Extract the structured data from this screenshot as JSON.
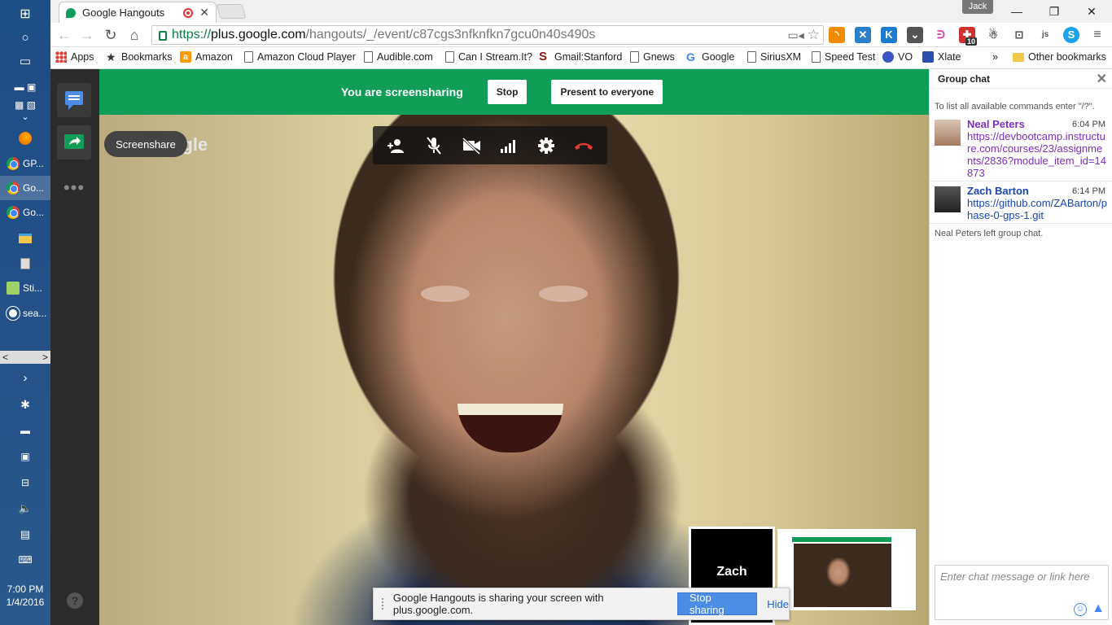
{
  "taskbar": {
    "apps": [
      {
        "label": "GP...",
        "active": false
      },
      {
        "label": "Go...",
        "active": true
      },
      {
        "label": "Go...",
        "active": false
      },
      {
        "label": "Sti...",
        "active": false
      },
      {
        "label": "sea...",
        "active": false
      }
    ],
    "time": "7:00 PM",
    "date": "1/4/2016"
  },
  "browser": {
    "tab_title": "Google Hangouts",
    "profile_name": "Jack",
    "url": {
      "scheme": "https://",
      "host": "plus.google.com",
      "path": "/hangouts/_/event/c87cgs3nfknfkn7gcu0n40s490s"
    },
    "extension_badge": "10",
    "bookmarks": [
      {
        "label": "Apps",
        "icon": "apps-grid-icon"
      },
      {
        "label": "Bookmarks",
        "icon": "star-icon"
      },
      {
        "label": "Amazon",
        "icon": "amazon-icon"
      },
      {
        "label": "Amazon Cloud Player",
        "icon": "page-icon"
      },
      {
        "label": "Audible.com",
        "icon": "page-icon"
      },
      {
        "label": "Can I Stream.It?",
        "icon": "page-icon"
      },
      {
        "label": "Gmail:Stanford",
        "icon": "stanford-icon"
      },
      {
        "label": "Gnews",
        "icon": "page-icon"
      },
      {
        "label": "Google",
        "icon": "google-icon"
      },
      {
        "label": "SiriusXM",
        "icon": "page-icon"
      },
      {
        "label": "Speed Test",
        "icon": "page-icon"
      },
      {
        "label": "VO",
        "icon": "vo-icon"
      },
      {
        "label": "Xlate",
        "icon": "xlate-icon"
      }
    ],
    "overflow": "»",
    "other_bookmarks": "Other bookmarks"
  },
  "hangout": {
    "banner_text": "You are screensharing",
    "stop_label": "Stop",
    "present_label": "Present to everyone",
    "tooltip": "Screenshare",
    "ghost_text": "ogle",
    "participant_name": "Zach",
    "notification_text": "Google Hangouts is sharing your screen with plus.google.com.",
    "stop_sharing_label": "Stop sharing",
    "hide_label": "Hide",
    "help": "?",
    "more": "•••"
  },
  "chat": {
    "title": "Group chat",
    "hint": "To list all available commands enter \"/?\".",
    "messages": [
      {
        "name": "Neal Peters",
        "time": "6:04 PM",
        "text": "https://devbootcamp.instructure.com/courses/23/assignments/2836?module_item_id=14873"
      },
      {
        "name": "Zach Barton",
        "time": "6:14 PM",
        "text": "https://github.com/ZABarton/phase-0-gps-1.git"
      }
    ],
    "left_notice": "Neal Peters left group chat.",
    "input_placeholder": "Enter chat message or link here"
  },
  "colors": {
    "hangouts_green": "#0f9d58",
    "taskbar_blue": "#1e4e86",
    "link_purple": "#7b2fbf",
    "link_blue": "#1a46b0"
  }
}
